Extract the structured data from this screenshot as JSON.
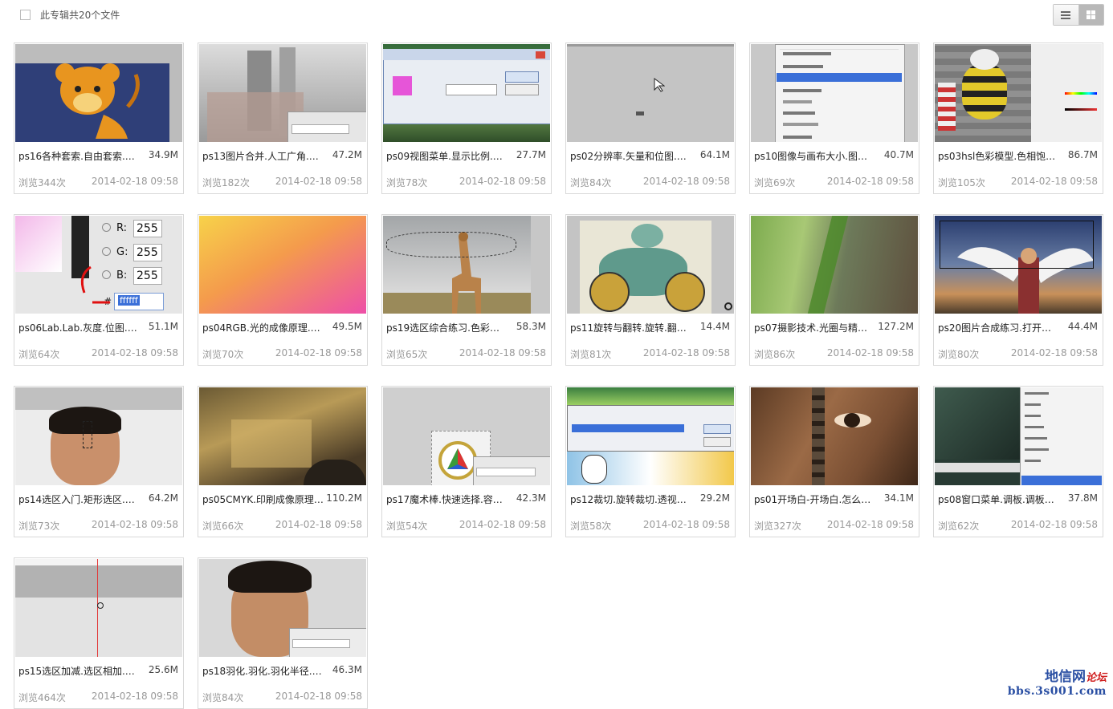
{
  "header": {
    "count_label": "此专辑共20个文件",
    "view_list_icon": "list-view-icon",
    "view_grid_icon": "grid-view-icon"
  },
  "files": [
    {
      "name": "ps16各种套索.自由套索.磁...",
      "size": "34.9M",
      "views": "浏览344次",
      "date": "2014-02-18 09:58",
      "thumb": "lion-cartoon"
    },
    {
      "name": "ps13图片合并.人工广角.图...",
      "size": "47.2M",
      "views": "浏览182次",
      "date": "2014-02-18 09:58",
      "thumb": "street-gray"
    },
    {
      "name": "ps09视图菜单.显示比例.放...",
      "size": "27.7M",
      "views": "浏览78次",
      "date": "2014-02-18 09:58",
      "thumb": "color-dialog"
    },
    {
      "name": "ps02分辨率.矢量和位图.像...",
      "size": "64.1M",
      "views": "浏览84次",
      "date": "2014-02-18 09:58",
      "thumb": "blank-gray"
    },
    {
      "name": "ps10图像与画布大小.图像...",
      "size": "40.7M",
      "views": "浏览69次",
      "date": "2014-02-18 09:58",
      "thumb": "image-menu"
    },
    {
      "name": "ps03hsl色彩模型.色相饱和...",
      "size": "86.7M",
      "views": "浏览105次",
      "date": "2014-02-18 09:58",
      "thumb": "graffiti-bee"
    },
    {
      "name": "ps06Lab.Lab.灰度.位图.色...",
      "size": "51.1M",
      "views": "浏览64次",
      "date": "2014-02-18 09:58",
      "thumb": "rgb-picker"
    },
    {
      "name": "ps04RGB.光的成像原理.红...",
      "size": "49.5M",
      "views": "浏览70次",
      "date": "2014-02-18 09:58",
      "thumb": "gradient"
    },
    {
      "name": "ps19选区综合练习.色彩范...",
      "size": "58.3M",
      "views": "浏览65次",
      "date": "2014-02-18 09:58",
      "thumb": "giraffe"
    },
    {
      "name": "ps11旋转与翻转.旋转.翻转...",
      "size": "14.4M",
      "views": "浏览81次",
      "date": "2014-02-18 09:58",
      "thumb": "monster"
    },
    {
      "name": "ps07摄影技术.光圈与精神...",
      "size": "127.2M",
      "views": "浏览86次",
      "date": "2014-02-18 09:58",
      "thumb": "blur-green"
    },
    {
      "name": "ps20图片合成练习.打开思...",
      "size": "44.4M",
      "views": "浏览80次",
      "date": "2014-02-18 09:58",
      "thumb": "angel-wings"
    },
    {
      "name": "ps14选区入门.矩形选区.椭...",
      "size": "64.2M",
      "views": "浏览73次",
      "date": "2014-02-18 09:58",
      "thumb": "face-man"
    },
    {
      "name": "ps05CMYK.印刷成像原理....",
      "size": "110.2M",
      "views": "浏览66次",
      "date": "2014-02-18 09:58",
      "thumb": "blurry-room"
    },
    {
      "name": "ps17魔术棒.快速选择.容差...",
      "size": "42.3M",
      "views": "浏览54次",
      "date": "2014-02-18 09:58",
      "thumb": "logo-layers"
    },
    {
      "name": "ps12裁切.旋转裁切.透视裁...",
      "size": "29.2M",
      "views": "浏览58次",
      "date": "2014-02-18 09:58",
      "thumb": "crop-dialog"
    },
    {
      "name": "ps01开场白-开场白.怎么学...",
      "size": "34.1M",
      "views": "浏览327次",
      "date": "2014-02-18 09:58",
      "thumb": "close-eye"
    },
    {
      "name": "ps08窗口菜单.调板.调板井...",
      "size": "37.8M",
      "views": "浏览62次",
      "date": "2014-02-18 09:58",
      "thumb": "window-menu"
    },
    {
      "name": "ps15选区加减.选区相加.选...",
      "size": "25.6M",
      "views": "浏览464次",
      "date": "2014-02-18 09:58",
      "thumb": "ruler-canvas"
    },
    {
      "name": "ps18羽化.羽化.羽化半径.选...",
      "size": "46.3M",
      "views": "浏览84次",
      "date": "2014-02-18 09:58",
      "thumb": "face-man-panel"
    }
  ],
  "thumb_text": {
    "rgb_r": "255",
    "rgb_g": "255",
    "rgb_b": "255",
    "rgb_r_label": "R:",
    "rgb_g_label": "G:",
    "rgb_b_label": "B:",
    "rgb_hash": "#",
    "rgb_hex": "ffffff"
  },
  "watermark": {
    "line1": "地信网",
    "line1_suffix": "论坛",
    "line2": "bbs.3s001.com"
  },
  "colors": {
    "border": "#d9d9d9",
    "muted_text": "#999999",
    "watermark_blue": "#2a4fa3",
    "watermark_red": "#d02020"
  }
}
